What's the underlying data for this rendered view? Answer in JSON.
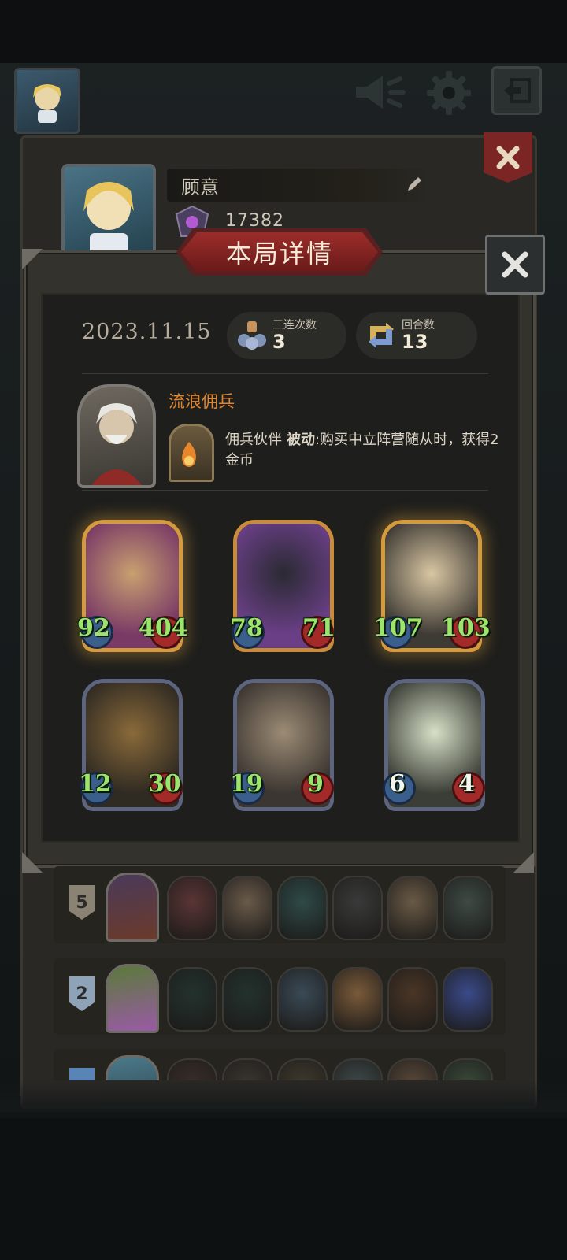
{
  "profile": {
    "player_name": "顾意",
    "score": "17382"
  },
  "dialog": {
    "title": "本局详情",
    "date": "2023.11.15",
    "stats": [
      {
        "label": "三连次数",
        "value": "3",
        "icon": "triple-units-icon"
      },
      {
        "label": "回合数",
        "value": "13",
        "icon": "rounds-cycle-icon"
      }
    ],
    "hero": {
      "name": "流浪佣兵",
      "skill_name": "佣兵伙伴",
      "skill_type": "被动",
      "skill_desc": ":购买中立阵营随从时，获得2金币"
    },
    "units": [
      {
        "name": "masked-knight",
        "attack": "92",
        "health": "404",
        "tier": "golden",
        "colors": [
          "#7a3a66",
          "#c8a070"
        ]
      },
      {
        "name": "shadow-panther",
        "attack": "78",
        "health": "71",
        "tier": "gold-rim",
        "colors": [
          "#6a3f86",
          "#2a2a33"
        ]
      },
      {
        "name": "mad-scientist",
        "attack": "107",
        "health": "103",
        "tier": "golden",
        "colors": [
          "#3e3a34",
          "#d9c7a3"
        ]
      },
      {
        "name": "treant",
        "attack": "12",
        "health": "30",
        "tier": "normal",
        "colors": [
          "#2f2a22",
          "#8a6a3a"
        ]
      },
      {
        "name": "rabbit-mask-warrior",
        "attack": "19",
        "health": "9",
        "tier": "normal",
        "colors": [
          "#3b3631",
          "#9c8b75"
        ]
      },
      {
        "name": "mandrake-root",
        "attack": "6",
        "health": "4",
        "tier": "normal",
        "colors": [
          "#3a3e36",
          "#d8e0c8"
        ]
      }
    ]
  },
  "history": [
    {
      "rank": "5",
      "shield_color": "#8a8272",
      "hero_colors": [
        "#4a3a5a",
        "#6b3a2a"
      ],
      "units": [
        "#5a3535",
        "#6a5a4a",
        "#2e4a48",
        "#3a3a3a",
        "#6a5a46",
        "#3e4a44"
      ]
    },
    {
      "rank": "2",
      "shield_color": "#8ea2b8",
      "hero_colors": [
        "#5a7a3a",
        "#9a5aa6"
      ],
      "units": [
        "#23322e",
        "#23322e",
        "#3a4a56",
        "#7a5a3a",
        "#4a3626",
        "#3a4a8a"
      ]
    },
    {
      "rank": "",
      "shield_color": "#5b84b6",
      "hero_colors": [
        "#4a7a8a",
        "#2e3e4a"
      ],
      "units": [
        "#3a2e2a",
        "#3a3630",
        "#403a2e",
        "#3e4a4a",
        "#5a4a3a",
        "#3a4a3a"
      ]
    }
  ],
  "colors": {
    "accent_orange": "#e0862c",
    "banner_red": "#9b2d2a",
    "stat_green": "#9ce46b"
  }
}
